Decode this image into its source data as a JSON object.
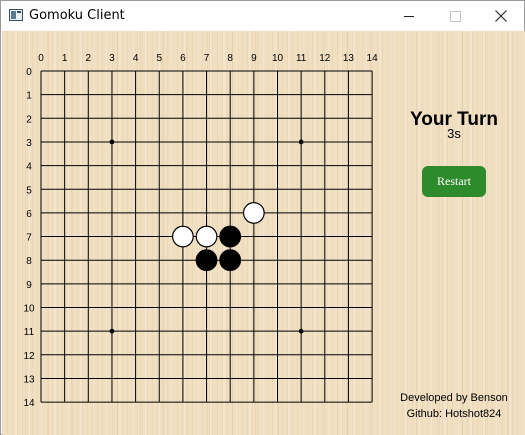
{
  "window": {
    "title": "Gomoku Client",
    "icon": "window-app-icon"
  },
  "board": {
    "column_labels": [
      "0",
      "1",
      "2",
      "3",
      "4",
      "5",
      "6",
      "7",
      "8",
      "9",
      "10",
      "11",
      "12",
      "13",
      "14"
    ],
    "row_labels": [
      "0",
      "1",
      "2",
      "3",
      "4",
      "5",
      "6",
      "7",
      "8",
      "9",
      "10",
      "11",
      "12",
      "13",
      "14"
    ],
    "star_points": [
      [
        3,
        3
      ],
      [
        3,
        11
      ],
      [
        11,
        3
      ],
      [
        11,
        11
      ]
    ],
    "stones": [
      {
        "col": 9,
        "row": 6,
        "color": "white"
      },
      {
        "col": 6,
        "row": 7,
        "color": "white"
      },
      {
        "col": 7,
        "row": 7,
        "color": "white"
      },
      {
        "col": 8,
        "row": 7,
        "color": "black"
      },
      {
        "col": 7,
        "row": 8,
        "color": "black"
      },
      {
        "col": 8,
        "row": 8,
        "color": "black"
      }
    ]
  },
  "status": {
    "turn_text": "Your Turn",
    "timer_text": "3s"
  },
  "controls": {
    "restart_label": "Restart"
  },
  "footer": {
    "developer": "Developed by Benson",
    "github": "Github: Hotshot824"
  },
  "colors": {
    "button_green": "#2e8b2c",
    "board_wood": "#f1dfc2",
    "grid_line": "#000000"
  }
}
